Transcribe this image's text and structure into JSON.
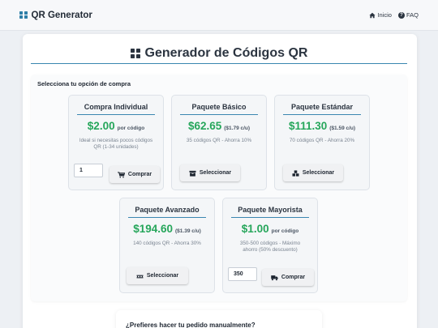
{
  "nav": {
    "brand": "QR Generator",
    "home_label": "Inicio",
    "faq_label": "FAQ"
  },
  "page": {
    "title": "Generador de Códigos QR",
    "section_title": "Selecciona tu opción de compra"
  },
  "packages": [
    {
      "title": "Compra Individual",
      "price": "$2.00",
      "unit": "por código",
      "desc": "Ideal si necesitas pocos códigos QR (1-34 unidades)",
      "quantity": "1",
      "button": "Comprar",
      "icon": "cart-icon"
    },
    {
      "title": "Paquete Básico",
      "price": "$62.65",
      "unit": "($1.79 c/u)",
      "desc": "35 códigos QR - Ahorra 10%",
      "button": "Seleccionar",
      "icon": "box-icon"
    },
    {
      "title": "Paquete Estándar",
      "price": "$111.30",
      "unit": "($1.59 c/u)",
      "desc": "70 códigos QR - Ahorra 20%",
      "button": "Seleccionar",
      "icon": "boxes-icon"
    },
    {
      "title": "Paquete Avanzado",
      "price": "$194.60",
      "unit": "($1.39 c/u)",
      "desc": "140 códigos QR - Ahorra 30%",
      "button": "Seleccionar",
      "icon": "pallet-icon"
    },
    {
      "title": "Paquete Mayorista",
      "price": "$1.00",
      "unit": "por código",
      "desc": "350-500 códigos - Máximo ahorro (50% descuento)",
      "quantity": "350",
      "button": "Comprar",
      "icon": "truck-icon"
    }
  ],
  "manual": {
    "title": "¿Prefieres hacer tu pedido manualmente?"
  },
  "colors": {
    "accent": "#3a86b0",
    "price": "#26a65b",
    "background": "#edf0f4"
  }
}
